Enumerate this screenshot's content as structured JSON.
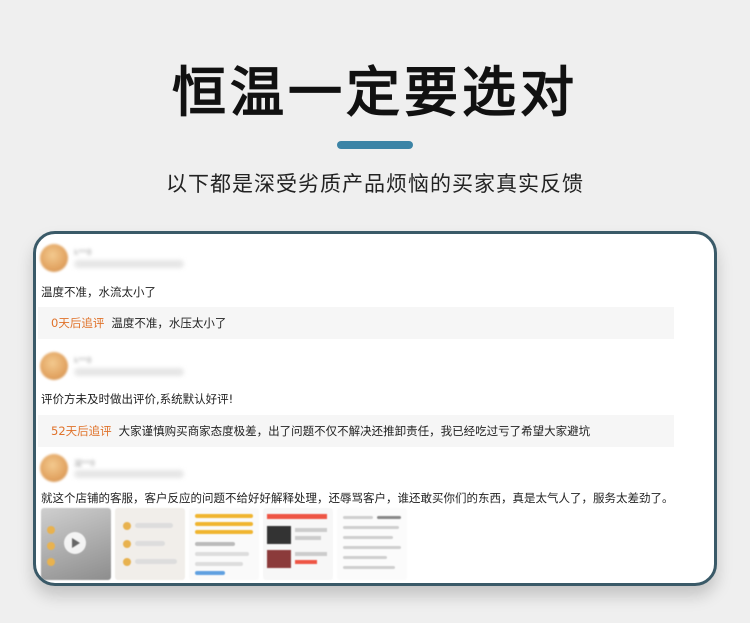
{
  "header": {
    "title": "恒温一定要选对",
    "subtitle": "以下都是深受劣质产品烦恼的买家真实反馈",
    "accent_color": "#3c84a6"
  },
  "reviews": [
    {
      "user_name": "k**8",
      "comment": "温度不准，水流太小了",
      "follow_tag": "0天后追评",
      "follow_text": "温度不准，水压太小了"
    },
    {
      "user_name": "k**8",
      "comment": "评价方未及时做出评价,系统默认好评!",
      "follow_tag": "52天后追评",
      "follow_text": "大家谨慎购买商家态度极差，出了问题不仅不解决还推卸责任，我已经吃过亏了希望大家避坑"
    },
    {
      "user_name": "凝**8",
      "comment": "就这个店铺的客服，客户反应的问题不给好好解释处理，还辱骂客户，谁还敢买你们的东西，真是太气人了，服务太差劲了。"
    }
  ],
  "images": [
    "video-thumbnail",
    "chat-screenshot",
    "order-screenshot",
    "product-screenshot",
    "message-screenshot"
  ]
}
